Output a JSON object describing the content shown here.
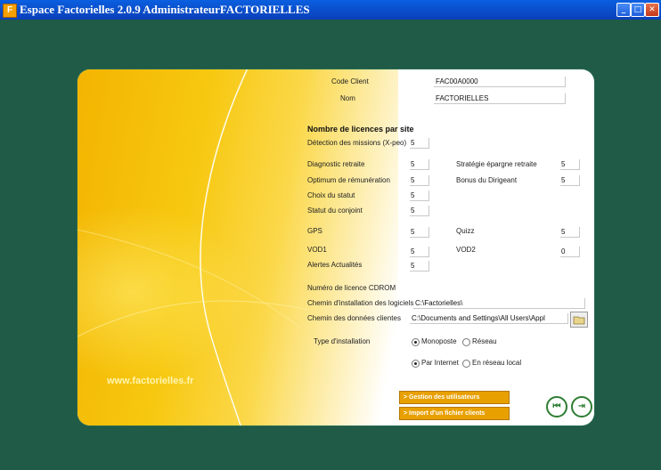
{
  "window": {
    "title": "Espace Factorielles 2.0.9  AdministrateurFACTORIELLES"
  },
  "brand": {
    "url": "www.factorielles.fr"
  },
  "client": {
    "code_label": "Code Client",
    "code_value": "FAC00A0000",
    "nom_label": "Nom",
    "nom_value": "FACTORIELLES"
  },
  "licences": {
    "heading": "Nombre de licences par site",
    "detection": {
      "label": "Détection des missions (X-peo)",
      "value": "5"
    },
    "diagnostic": {
      "label": "Diagnostic retraite",
      "value": "5"
    },
    "strategie": {
      "label": "Stratégie épargne retraite",
      "value": "5"
    },
    "optimum": {
      "label": "Optimum de rémunération",
      "value": "5"
    },
    "bonus": {
      "label": "Bonus du Dirigeant",
      "value": "5"
    },
    "choix": {
      "label": "Choix du statut",
      "value": "5"
    },
    "statut_conjoint": {
      "label": "Statut du conjoint",
      "value": "5"
    },
    "gps": {
      "label": "GPS",
      "value": "5"
    },
    "quizz": {
      "label": "Quizz",
      "value": "5"
    },
    "vod1": {
      "label": "VOD1",
      "value": "5"
    },
    "vod2": {
      "label": "VOD2",
      "value": "0"
    },
    "alertes": {
      "label": "Alertes Actualités",
      "value": "5"
    }
  },
  "install": {
    "cdrom_label": "Numéro de licence CDROM",
    "chemin_logiciels_label": "Chemin d'installation des logiciels",
    "chemin_logiciels_value": "C:\\Factorielles\\",
    "chemin_donnees_label": "Chemin des données clientes",
    "chemin_donnees_value": "C:\\Documents and Settings\\All Users\\Appl",
    "type_label": "Type d'installation",
    "monoposte": "Monoposte",
    "reseau": "Réseau",
    "par_internet": "Par Internet",
    "reseau_local": "En réseau local"
  },
  "buttons": {
    "gestion_utilisateurs": "> Gestion des utilisateurs",
    "import_clients": "> Import d'un fichier clients"
  },
  "nav": {
    "back": "⏮",
    "exit": "⇥"
  }
}
